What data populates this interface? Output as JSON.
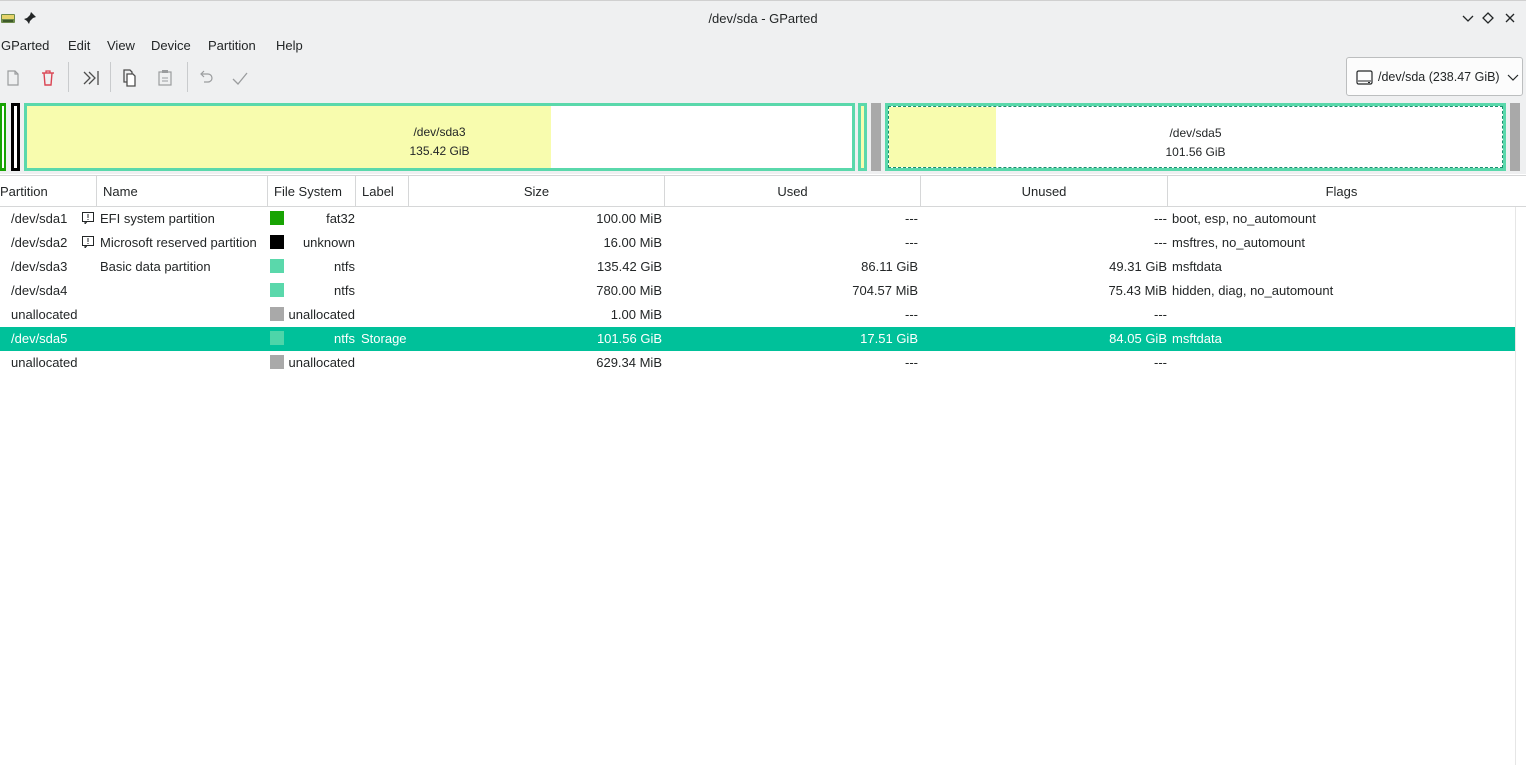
{
  "window": {
    "title": "/dev/sda - GParted",
    "icons": [
      "gparted-app-icon",
      "pin-icon",
      "minimize-chevron-icon",
      "maximize-diamond-icon",
      "close-x-icon"
    ]
  },
  "menu": {
    "items": [
      "GParted",
      "Edit",
      "View",
      "Device",
      "Partition",
      "Help"
    ]
  },
  "toolbar": {
    "buttons": [
      "new-partition-icon",
      "delete-icon",
      "resize-move-icon",
      "copy-icon",
      "paste-icon",
      "undo-icon",
      "apply-icon"
    ]
  },
  "device_selector": {
    "label": "/dev/sda (238.47 GiB)"
  },
  "disk_visual": {
    "segments": [
      {
        "label": "/dev/sda3",
        "size": "135.42 GiB"
      },
      {
        "label": "/dev/sda5",
        "size": "101.56 GiB"
      }
    ],
    "colors": {
      "fat32": "#18a303",
      "unknown": "#000000",
      "ntfs": "#5ad8ab",
      "unallocated": "#a9a9a9",
      "used_fill": "#f8fcae",
      "selection": "#00c19a"
    }
  },
  "table": {
    "columns": [
      "Partition",
      "Name",
      "File System",
      "Label",
      "Size",
      "Used",
      "Unused",
      "Flags"
    ],
    "rows": [
      {
        "partition": "/dev/sda1",
        "warn": true,
        "name": "EFI system partition",
        "fs": "fat32",
        "label": "",
        "size": "100.00 MiB",
        "used": "---",
        "unused": "---",
        "flags": "boot, esp, no_automount"
      },
      {
        "partition": "/dev/sda2",
        "warn": true,
        "name": "Microsoft reserved partition",
        "fs": "unknown",
        "label": "",
        "size": "16.00 MiB",
        "used": "---",
        "unused": "---",
        "flags": "msftres, no_automount"
      },
      {
        "partition": "/dev/sda3",
        "warn": false,
        "name": "Basic data partition",
        "fs": "ntfs",
        "label": "",
        "size": "135.42 GiB",
        "used": "86.11 GiB",
        "unused": "49.31 GiB",
        "flags": "msftdata"
      },
      {
        "partition": "/dev/sda4",
        "warn": false,
        "name": "",
        "fs": "ntfs",
        "label": "",
        "size": "780.00 MiB",
        "used": "704.57 MiB",
        "unused": "75.43 MiB",
        "flags": "hidden, diag, no_automount"
      },
      {
        "partition": "unallocated",
        "warn": false,
        "name": "",
        "fs": "unallocated",
        "label": "",
        "size": "1.00 MiB",
        "used": "---",
        "unused": "---",
        "flags": ""
      },
      {
        "partition": "/dev/sda5",
        "warn": false,
        "name": "",
        "fs": "ntfs",
        "label": "Storage",
        "size": "101.56 GiB",
        "used": "17.51 GiB",
        "unused": "84.05 GiB",
        "flags": "msftdata"
      },
      {
        "partition": "unallocated",
        "warn": false,
        "name": "",
        "fs": "unallocated",
        "label": "",
        "size": "629.34 MiB",
        "used": "---",
        "unused": "---",
        "flags": ""
      }
    ]
  }
}
